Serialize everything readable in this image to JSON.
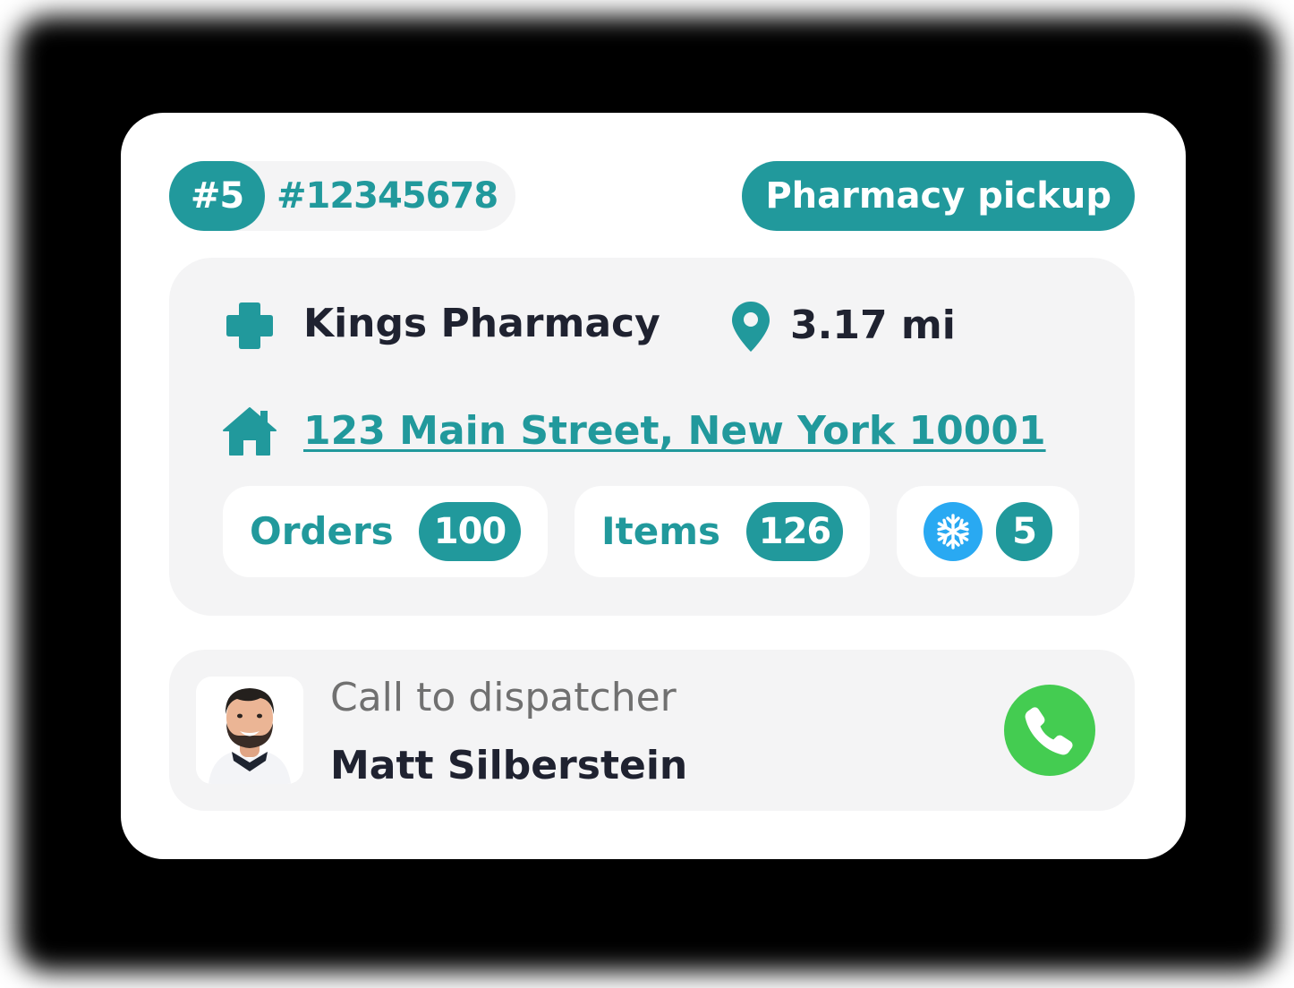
{
  "header": {
    "stop_number": "#5",
    "order_id": "#12345678",
    "pickup_type": "Pharmacy pickup"
  },
  "pharmacy": {
    "name": "Kings Pharmacy",
    "distance": "3.17 mi",
    "address": "123 Main Street, New York 10001"
  },
  "stats": {
    "orders_label": "Orders",
    "orders_count": "100",
    "items_label": "Items",
    "items_count": "126",
    "cold_count": "5"
  },
  "dispatcher": {
    "call_label": "Call to dispatcher",
    "name": "Matt Silberstein"
  },
  "icons": {
    "pharmacy": "medical-cross-icon",
    "distance": "map-pin-icon",
    "address": "home-icon",
    "cold_chain": "snowflake-icon",
    "call": "phone-icon"
  },
  "colors": {
    "accent": "#21999c",
    "call_green": "#44cc51",
    "snowflake_blue": "#29a9f2",
    "text_dark": "#1f2230",
    "text_muted": "#707070",
    "panel_bg": "#f4f4f5"
  }
}
